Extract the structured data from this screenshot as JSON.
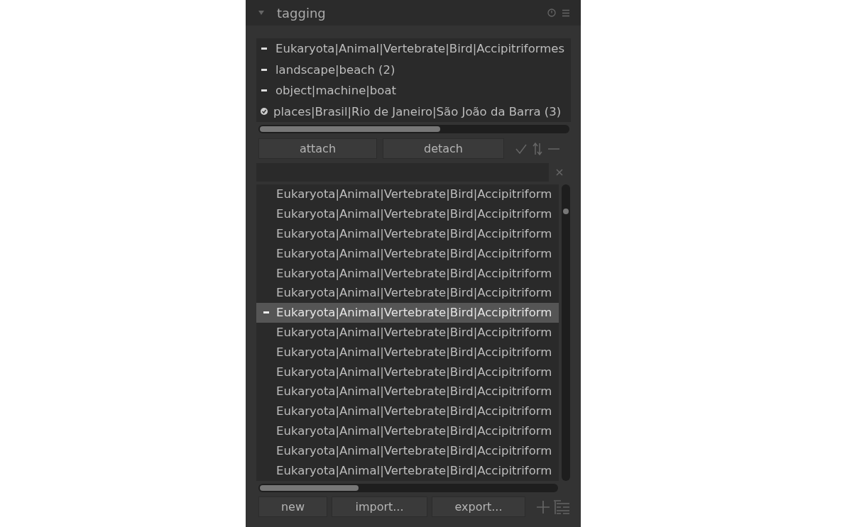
{
  "header": {
    "title": "tagging"
  },
  "attached": [
    {
      "label": "Eukaryota|Animal|Vertebrate|Bird|Accipitriformes",
      "checked": false
    },
    {
      "label": "landscape|beach (2)",
      "checked": false
    },
    {
      "label": "object|machine|boat",
      "checked": false
    },
    {
      "label": "places|Brasil|Rio de Janeiro|São João da Barra (3)",
      "checked": true
    }
  ],
  "actions": [
    "attach",
    "detach"
  ],
  "dictionary": [
    {
      "label": "Eukaryota|Animal|Vertebrate|Bird|Accipitriform",
      "selected": false,
      "attached": false
    },
    {
      "label": "Eukaryota|Animal|Vertebrate|Bird|Accipitriform",
      "selected": false,
      "attached": false
    },
    {
      "label": "Eukaryota|Animal|Vertebrate|Bird|Accipitriform",
      "selected": false,
      "attached": false
    },
    {
      "label": "Eukaryota|Animal|Vertebrate|Bird|Accipitriform",
      "selected": false,
      "attached": false
    },
    {
      "label": "Eukaryota|Animal|Vertebrate|Bird|Accipitriform",
      "selected": false,
      "attached": false
    },
    {
      "label": "Eukaryota|Animal|Vertebrate|Bird|Accipitriform",
      "selected": false,
      "attached": false
    },
    {
      "label": "Eukaryota|Animal|Vertebrate|Bird|Accipitriform",
      "selected": true,
      "attached": true
    },
    {
      "label": "Eukaryota|Animal|Vertebrate|Bird|Accipitriform",
      "selected": false,
      "attached": false
    },
    {
      "label": "Eukaryota|Animal|Vertebrate|Bird|Accipitriform",
      "selected": false,
      "attached": false
    },
    {
      "label": "Eukaryota|Animal|Vertebrate|Bird|Accipitriform",
      "selected": false,
      "attached": false
    },
    {
      "label": "Eukaryota|Animal|Vertebrate|Bird|Accipitriform",
      "selected": false,
      "attached": false
    },
    {
      "label": "Eukaryota|Animal|Vertebrate|Bird|Accipitriform",
      "selected": false,
      "attached": false
    },
    {
      "label": "Eukaryota|Animal|Vertebrate|Bird|Accipitriform",
      "selected": false,
      "attached": false
    },
    {
      "label": "Eukaryota|Animal|Vertebrate|Bird|Accipitriform",
      "selected": false,
      "attached": false
    },
    {
      "label": "Eukaryota|Animal|Vertebrate|Bird|Accipitriform",
      "selected": false,
      "attached": false
    }
  ],
  "footer": [
    "new",
    "import...",
    "export..."
  ]
}
